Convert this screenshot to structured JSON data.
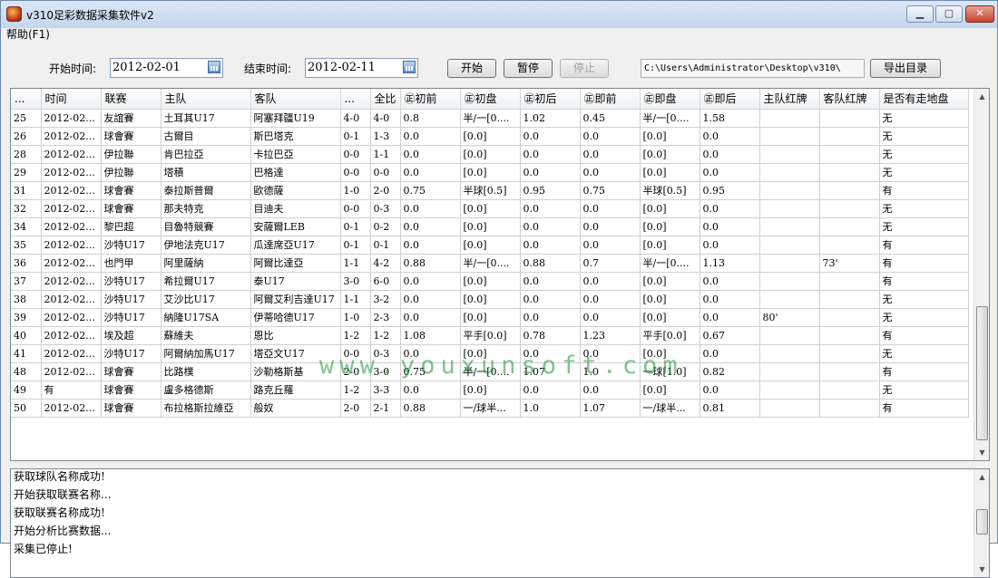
{
  "window": {
    "title": "v310足彩数据采集软件v2"
  },
  "menu": {
    "help": "帮助(F1)"
  },
  "toolbar": {
    "start_time_label": "开始时间:",
    "start_date": "2012-02-01",
    "end_time_label": "结束时间:",
    "end_date": "2012-02-11",
    "start_button": "开始",
    "pause_button": "暂停",
    "stop_button": "停止",
    "path": "C:\\Users\\Administrator\\Desktop\\v310\\",
    "export_button": "导出目录"
  },
  "table": {
    "headers": [
      "...",
      "时间",
      "联赛",
      "主队",
      "客队",
      "...",
      "全比",
      "㊣初前",
      "㊣初盘",
      "㊣初后",
      "㊣即前",
      "㊣即盘",
      "㊣即后",
      "主队红牌",
      "客队红牌",
      "是否有走地盘"
    ],
    "rows": [
      [
        "25",
        "2012-02...",
        "友誼賽",
        "土耳其U17",
        "阿塞拜疆U19",
        "4-0",
        "4-0",
        "0.8",
        "半/一[0....",
        "1.02",
        "0.45",
        "半/一[0....",
        "1.58",
        "",
        "",
        "无"
      ],
      [
        "26",
        "2012-02...",
        "球會賽",
        "古爾目",
        "斯巴塔克",
        "0-1",
        "1-3",
        "0.0",
        "[0.0]",
        "0.0",
        "0.0",
        "[0.0]",
        "0.0",
        "",
        "",
        "无"
      ],
      [
        "28",
        "2012-02...",
        "伊拉聯",
        "肯巴拉亞",
        "卡拉巴亞",
        "0-0",
        "1-1",
        "0.0",
        "[0.0]",
        "0.0",
        "0.0",
        "[0.0]",
        "0.0",
        "",
        "",
        "无"
      ],
      [
        "29",
        "2012-02...",
        "伊拉聯",
        "塔積",
        "巴格達",
        "0-0",
        "0-0",
        "0.0",
        "[0.0]",
        "0.0",
        "0.0",
        "[0.0]",
        "0.0",
        "",
        "",
        "无"
      ],
      [
        "31",
        "2012-02...",
        "球會賽",
        "泰拉斯普爾",
        "歐德薩",
        "1-0",
        "2-0",
        "0.75",
        "半球[0.5]",
        "0.95",
        "0.75",
        "半球[0.5]",
        "0.95",
        "",
        "",
        "有"
      ],
      [
        "32",
        "2012-02...",
        "球會賽",
        "那夫特克",
        "目迪夫",
        "0-0",
        "0-3",
        "0.0",
        "[0.0]",
        "0.0",
        "0.0",
        "[0.0]",
        "0.0",
        "",
        "",
        "无"
      ],
      [
        "34",
        "2012-02...",
        "黎巴超",
        "目魯特競賽",
        "安薩爾LEB",
        "0-1",
        "0-2",
        "0.0",
        "[0.0]",
        "0.0",
        "0.0",
        "[0.0]",
        "0.0",
        "",
        "",
        "无"
      ],
      [
        "35",
        "2012-02...",
        "沙特U17",
        "伊地法克U17",
        "瓜達席亞U17",
        "0-1",
        "0-1",
        "0.0",
        "[0.0]",
        "0.0",
        "0.0",
        "[0.0]",
        "0.0",
        "",
        "",
        "有"
      ],
      [
        "36",
        "2012-02...",
        "也門甲",
        "阿里薩納",
        "阿爾比達亞",
        "1-1",
        "4-2",
        "0.88",
        "半/一[0....",
        "0.88",
        "0.7",
        "半/一[0....",
        "1.13",
        "",
        "73'",
        "有"
      ],
      [
        "37",
        "2012-02...",
        "沙特U17",
        "希拉爾U17",
        "泰U17",
        "3-0",
        "6-0",
        "0.0",
        "[0.0]",
        "0.0",
        "0.0",
        "[0.0]",
        "0.0",
        "",
        "",
        "有"
      ],
      [
        "38",
        "2012-02...",
        "沙特U17",
        "艾沙比U17",
        "阿爾艾利吉達U17",
        "1-1",
        "3-2",
        "0.0",
        "[0.0]",
        "0.0",
        "0.0",
        "[0.0]",
        "0.0",
        "",
        "",
        "无"
      ],
      [
        "39",
        "2012-02...",
        "沙特U17",
        "納隆U17SA",
        "伊蒂哈德U17",
        "1-0",
        "2-3",
        "0.0",
        "[0.0]",
        "0.0",
        "0.0",
        "[0.0]",
        "0.0",
        "80'",
        "",
        "无"
      ],
      [
        "40",
        "2012-02...",
        "埃及超",
        "蘇維夫",
        "恩比",
        "1-2",
        "1-2",
        "1.08",
        "平手[0.0]",
        "0.78",
        "1.23",
        "平手[0.0]",
        "0.67",
        "",
        "",
        "有"
      ],
      [
        "41",
        "2012-02...",
        "沙特U17",
        "阿爾納加馬U17",
        "塔亞文U17",
        "0-0",
        "0-3",
        "0.0",
        "[0.0]",
        "0.0",
        "0.0",
        "[0.0]",
        "0.0",
        "",
        "",
        "无"
      ],
      [
        "48",
        "2012-02...",
        "球會賽",
        "比路樸",
        "沙勒格斯基",
        "2-0",
        "3-0",
        "0.75",
        "半/一[0....",
        "1.07",
        "1.0",
        "一球[1.0]",
        "0.82",
        "",
        "",
        "有"
      ],
      [
        "49",
        "有",
        "球會賽",
        "盧多格德斯",
        "路克丘羅",
        "1-2",
        "3-3",
        "0.0",
        "[0.0]",
        "0.0",
        "0.0",
        "[0.0]",
        "0.0",
        "",
        "",
        "无"
      ],
      [
        "50",
        "2012-02...",
        "球會賽",
        "布拉格斯拉維亞",
        "般奴",
        "2-0",
        "2-1",
        "0.88",
        "一/球半...",
        "1.0",
        "1.07",
        "一/球半...",
        "0.81",
        "",
        "",
        "有"
      ]
    ]
  },
  "watermark": "www.youxunsoft.com",
  "log": {
    "lines": [
      "获取球队名称成功!",
      "开始获取联赛名称...",
      "获取联赛名称成功!",
      "开始分析比赛数据...",
      "采集已停止!"
    ]
  }
}
